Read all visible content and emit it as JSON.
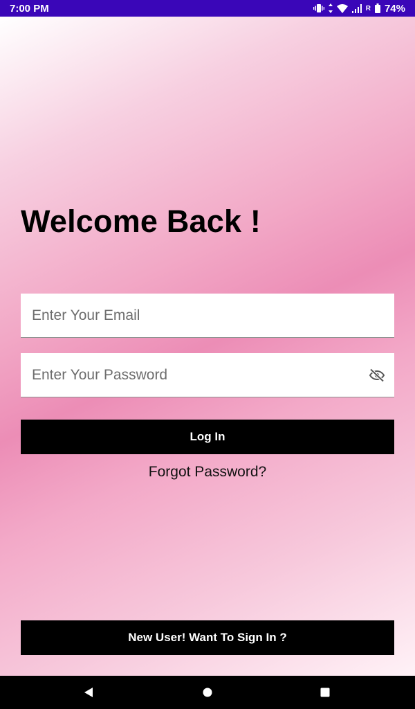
{
  "status_bar": {
    "time": "7:00 PM",
    "roaming_indicator": "R",
    "battery_percent": "74%",
    "icons": [
      "vibrate-icon",
      "data-arrows-icon",
      "wifi-icon",
      "cell-signal-icon",
      "battery-icon"
    ],
    "background_color": "#3a06b8"
  },
  "login": {
    "heading": "Welcome Back !",
    "email": {
      "placeholder": "Enter Your Email",
      "value": ""
    },
    "password": {
      "placeholder": "Enter Your Password",
      "value": "",
      "toggle_icon": "visibility-off-icon"
    },
    "login_button": "Log In",
    "forgot_password": "Forgot Password?",
    "signup_button": "New User! Want To Sign In ?"
  },
  "colors": {
    "button_background": "#000000",
    "button_text": "#ffffff",
    "gradient_accent": "#ec8db6"
  },
  "nav_bar": {
    "icons": [
      "back-icon",
      "home-icon",
      "recents-icon"
    ]
  }
}
